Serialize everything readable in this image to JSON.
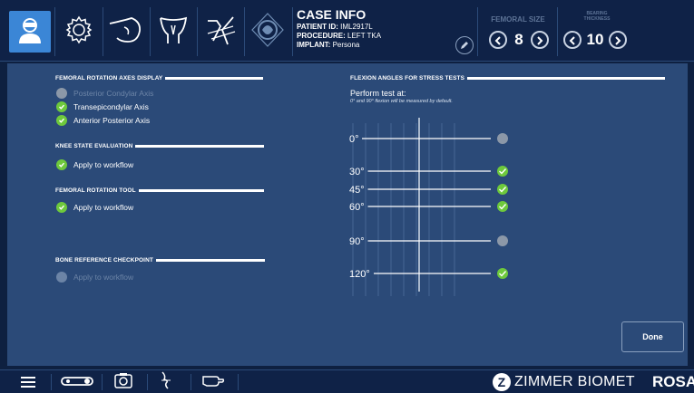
{
  "case_info": {
    "title": "CASE INFO",
    "patient_id_label": "PATIENT ID:",
    "patient_id": "IML2917L",
    "procedure_label": "PROCEDURE:",
    "procedure": "LEFT TKA",
    "implant_label": "IMPLANT:",
    "implant": "Persona"
  },
  "femoral_size": {
    "label": "FEMORAL SIZE",
    "value": "8"
  },
  "bearing_thickness": {
    "label_line1": "BEARING",
    "label_line2": "THICKNESS",
    "value": "10"
  },
  "rotation_axes": {
    "header": "FEMORAL ROTATION AXES DISPLAY",
    "items": [
      {
        "label": "Posterior Condylar Axis",
        "enabled": false
      },
      {
        "label": "Transepicondylar Axis",
        "enabled": true
      },
      {
        "label": "Anterior Posterior Axis",
        "enabled": true
      }
    ]
  },
  "knee_state": {
    "header": "KNEE STATE EVALUATION",
    "option": "Apply to workflow",
    "enabled": true
  },
  "femoral_rotation_tool": {
    "header": "FEMORAL ROTATION TOOL",
    "option": "Apply to workflow",
    "enabled": true
  },
  "bone_reference": {
    "header": "BONE REFERENCE CHECKPOINT",
    "option": "Apply to workflow",
    "enabled": false
  },
  "flexion": {
    "header": "FLEXION ANGLES FOR STRESS TESTS",
    "perform": "Perform test at:",
    "note": "0° and 90° flexion will be measured by default.",
    "angles": [
      {
        "label": "0°",
        "selected": false
      },
      {
        "label": "30°",
        "selected": true
      },
      {
        "label": "45°",
        "selected": true
      },
      {
        "label": "60°",
        "selected": true
      },
      {
        "label": "90°",
        "selected": false
      },
      {
        "label": "120°",
        "selected": true
      }
    ]
  },
  "done_label": "Done",
  "brand": {
    "name": "ZIMMER BIOMET",
    "logo_letter": "Z",
    "product": "ROSA"
  },
  "colors": {
    "accent": "#3b86d6",
    "check": "#6ec93c",
    "panel": "#2b4a78",
    "bar": "#0f2247"
  }
}
